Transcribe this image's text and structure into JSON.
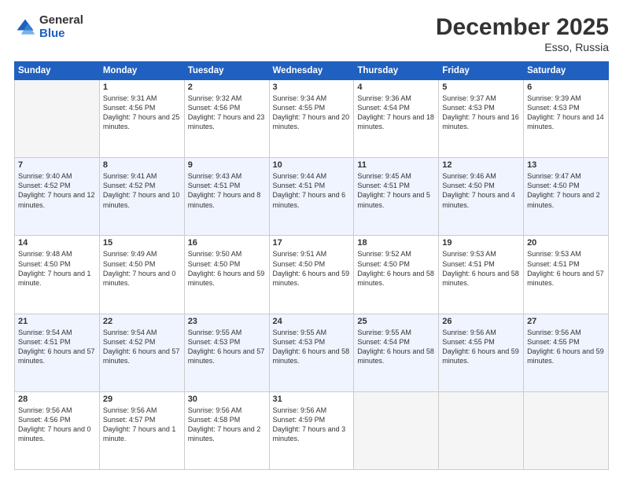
{
  "logo": {
    "general": "General",
    "blue": "Blue"
  },
  "header": {
    "month": "December 2025",
    "location": "Esso, Russia"
  },
  "days_of_week": [
    "Sunday",
    "Monday",
    "Tuesday",
    "Wednesday",
    "Thursday",
    "Friday",
    "Saturday"
  ],
  "weeks": [
    [
      {
        "day": "",
        "info": ""
      },
      {
        "day": "1",
        "sunrise": "Sunrise: 9:31 AM",
        "sunset": "Sunset: 4:56 PM",
        "daylight": "Daylight: 7 hours and 25 minutes."
      },
      {
        "day": "2",
        "sunrise": "Sunrise: 9:32 AM",
        "sunset": "Sunset: 4:56 PM",
        "daylight": "Daylight: 7 hours and 23 minutes."
      },
      {
        "day": "3",
        "sunrise": "Sunrise: 9:34 AM",
        "sunset": "Sunset: 4:55 PM",
        "daylight": "Daylight: 7 hours and 20 minutes."
      },
      {
        "day": "4",
        "sunrise": "Sunrise: 9:36 AM",
        "sunset": "Sunset: 4:54 PM",
        "daylight": "Daylight: 7 hours and 18 minutes."
      },
      {
        "day": "5",
        "sunrise": "Sunrise: 9:37 AM",
        "sunset": "Sunset: 4:53 PM",
        "daylight": "Daylight: 7 hours and 16 minutes."
      },
      {
        "day": "6",
        "sunrise": "Sunrise: 9:39 AM",
        "sunset": "Sunset: 4:53 PM",
        "daylight": "Daylight: 7 hours and 14 minutes."
      }
    ],
    [
      {
        "day": "7",
        "sunrise": "Sunrise: 9:40 AM",
        "sunset": "Sunset: 4:52 PM",
        "daylight": "Daylight: 7 hours and 12 minutes."
      },
      {
        "day": "8",
        "sunrise": "Sunrise: 9:41 AM",
        "sunset": "Sunset: 4:52 PM",
        "daylight": "Daylight: 7 hours and 10 minutes."
      },
      {
        "day": "9",
        "sunrise": "Sunrise: 9:43 AM",
        "sunset": "Sunset: 4:51 PM",
        "daylight": "Daylight: 7 hours and 8 minutes."
      },
      {
        "day": "10",
        "sunrise": "Sunrise: 9:44 AM",
        "sunset": "Sunset: 4:51 PM",
        "daylight": "Daylight: 7 hours and 6 minutes."
      },
      {
        "day": "11",
        "sunrise": "Sunrise: 9:45 AM",
        "sunset": "Sunset: 4:51 PM",
        "daylight": "Daylight: 7 hours and 5 minutes."
      },
      {
        "day": "12",
        "sunrise": "Sunrise: 9:46 AM",
        "sunset": "Sunset: 4:50 PM",
        "daylight": "Daylight: 7 hours and 4 minutes."
      },
      {
        "day": "13",
        "sunrise": "Sunrise: 9:47 AM",
        "sunset": "Sunset: 4:50 PM",
        "daylight": "Daylight: 7 hours and 2 minutes."
      }
    ],
    [
      {
        "day": "14",
        "sunrise": "Sunrise: 9:48 AM",
        "sunset": "Sunset: 4:50 PM",
        "daylight": "Daylight: 7 hours and 1 minute."
      },
      {
        "day": "15",
        "sunrise": "Sunrise: 9:49 AM",
        "sunset": "Sunset: 4:50 PM",
        "daylight": "Daylight: 7 hours and 0 minutes."
      },
      {
        "day": "16",
        "sunrise": "Sunrise: 9:50 AM",
        "sunset": "Sunset: 4:50 PM",
        "daylight": "Daylight: 6 hours and 59 minutes."
      },
      {
        "day": "17",
        "sunrise": "Sunrise: 9:51 AM",
        "sunset": "Sunset: 4:50 PM",
        "daylight": "Daylight: 6 hours and 59 minutes."
      },
      {
        "day": "18",
        "sunrise": "Sunrise: 9:52 AM",
        "sunset": "Sunset: 4:50 PM",
        "daylight": "Daylight: 6 hours and 58 minutes."
      },
      {
        "day": "19",
        "sunrise": "Sunrise: 9:53 AM",
        "sunset": "Sunset: 4:51 PM",
        "daylight": "Daylight: 6 hours and 58 minutes."
      },
      {
        "day": "20",
        "sunrise": "Sunrise: 9:53 AM",
        "sunset": "Sunset: 4:51 PM",
        "daylight": "Daylight: 6 hours and 57 minutes."
      }
    ],
    [
      {
        "day": "21",
        "sunrise": "Sunrise: 9:54 AM",
        "sunset": "Sunset: 4:51 PM",
        "daylight": "Daylight: 6 hours and 57 minutes."
      },
      {
        "day": "22",
        "sunrise": "Sunrise: 9:54 AM",
        "sunset": "Sunset: 4:52 PM",
        "daylight": "Daylight: 6 hours and 57 minutes."
      },
      {
        "day": "23",
        "sunrise": "Sunrise: 9:55 AM",
        "sunset": "Sunset: 4:53 PM",
        "daylight": "Daylight: 6 hours and 57 minutes."
      },
      {
        "day": "24",
        "sunrise": "Sunrise: 9:55 AM",
        "sunset": "Sunset: 4:53 PM",
        "daylight": "Daylight: 6 hours and 58 minutes."
      },
      {
        "day": "25",
        "sunrise": "Sunrise: 9:55 AM",
        "sunset": "Sunset: 4:54 PM",
        "daylight": "Daylight: 6 hours and 58 minutes."
      },
      {
        "day": "26",
        "sunrise": "Sunrise: 9:56 AM",
        "sunset": "Sunset: 4:55 PM",
        "daylight": "Daylight: 6 hours and 59 minutes."
      },
      {
        "day": "27",
        "sunrise": "Sunrise: 9:56 AM",
        "sunset": "Sunset: 4:55 PM",
        "daylight": "Daylight: 6 hours and 59 minutes."
      }
    ],
    [
      {
        "day": "28",
        "sunrise": "Sunrise: 9:56 AM",
        "sunset": "Sunset: 4:56 PM",
        "daylight": "Daylight: 7 hours and 0 minutes."
      },
      {
        "day": "29",
        "sunrise": "Sunrise: 9:56 AM",
        "sunset": "Sunset: 4:57 PM",
        "daylight": "Daylight: 7 hours and 1 minute."
      },
      {
        "day": "30",
        "sunrise": "Sunrise: 9:56 AM",
        "sunset": "Sunset: 4:58 PM",
        "daylight": "Daylight: 7 hours and 2 minutes."
      },
      {
        "day": "31",
        "sunrise": "Sunrise: 9:56 AM",
        "sunset": "Sunset: 4:59 PM",
        "daylight": "Daylight: 7 hours and 3 minutes."
      },
      {
        "day": "",
        "info": ""
      },
      {
        "day": "",
        "info": ""
      },
      {
        "day": "",
        "info": ""
      }
    ]
  ]
}
